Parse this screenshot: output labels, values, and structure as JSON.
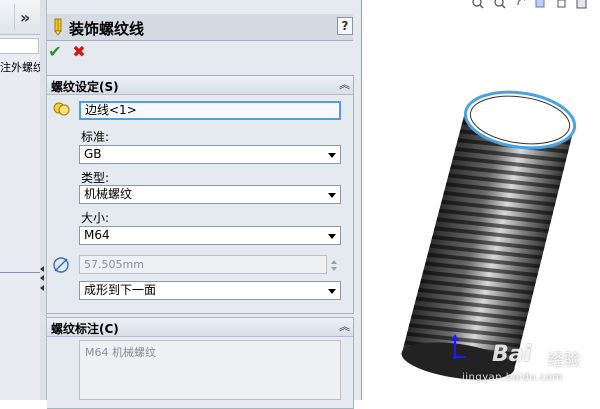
{
  "tree_panel": {
    "chevron": "»",
    "feature_item": "注外螺纹"
  },
  "property_manager": {
    "title": "装饰螺纹线",
    "help": "?",
    "ok_icon": "check-icon",
    "cancel_icon": "x-icon",
    "thread_settings": {
      "header": "螺纹设定(S)",
      "edge_value": "边线<1>",
      "standard_label": "标准:",
      "standard_value": "GB",
      "type_label": "类型:",
      "type_value": "机械螺纹",
      "size_label": "大小:",
      "size_value": "M64",
      "diameter_value": "57.505mm",
      "end_condition_value": "成形到下一面"
    },
    "thread_callout": {
      "header": "螺纹标注(C)",
      "callout_text": "M64 机械螺纹"
    }
  },
  "viewport": {
    "watermark_brand": "Bai",
    "watermark_cn": "经验",
    "watermark_url": "jingyan.baidu.com",
    "colors": {
      "selection_edge": "#4aa3df",
      "triad_axis": "#1a1aff"
    }
  }
}
